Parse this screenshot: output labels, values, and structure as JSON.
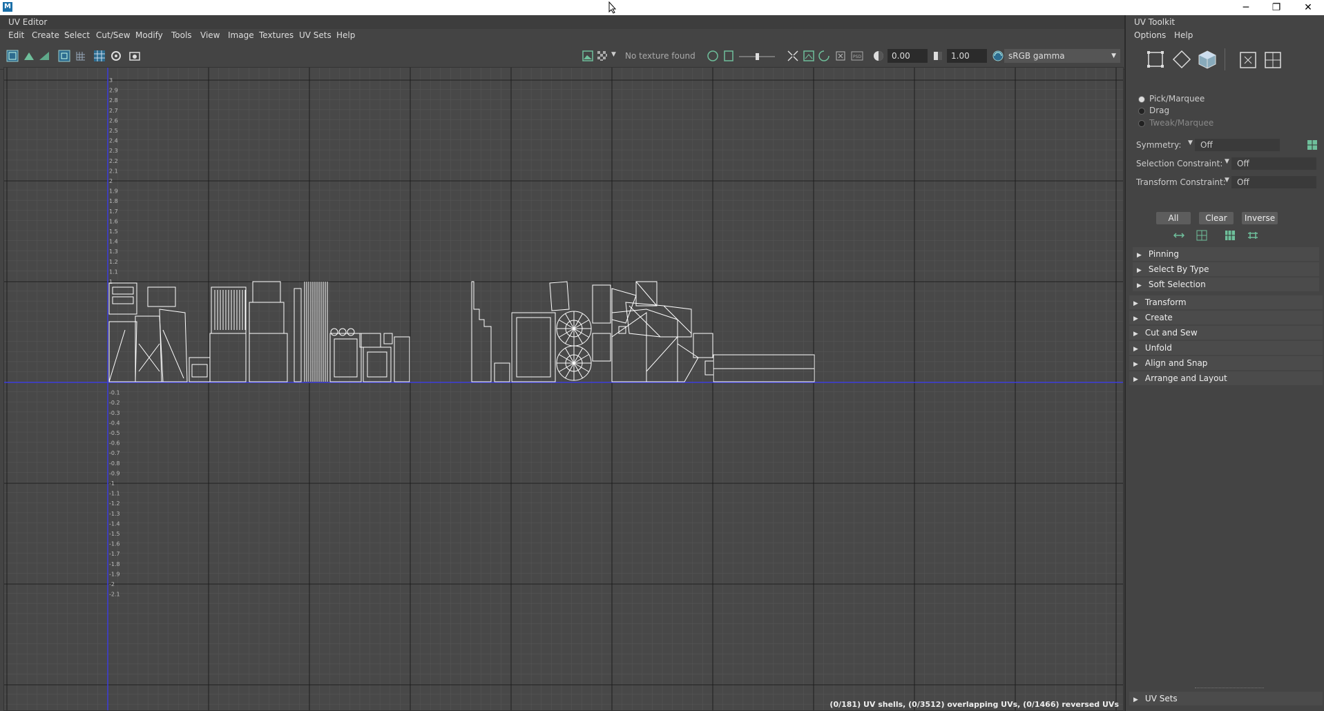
{
  "window": {
    "app_logo": "M",
    "minimize": "─",
    "restore": "❐",
    "close": "✕"
  },
  "uv_editor": {
    "title": "UV Editor",
    "menu": [
      "Edit",
      "Create",
      "Select",
      "Cut/Sew",
      "Modify",
      "Tools",
      "View",
      "Image",
      "Textures",
      "UV Sets",
      "Help"
    ],
    "texture_status": "No texture found",
    "exposure": "0.00",
    "gamma": "1.00",
    "color_space": "sRGB gamma",
    "status_bar": "(0/181) UV shells, (0/3512) overlapping UVs, (0/1466) reversed UVs",
    "axis_labels_v_pos": [
      "3",
      "2.9",
      "2.8",
      "2.7",
      "2.6",
      "2.5",
      "2.4",
      "2.3",
      "2.2",
      "2.1",
      "2",
      "1.9",
      "1.8",
      "1.7",
      "1.6",
      "1.5",
      "1.4",
      "1.3",
      "1.2",
      "1.1",
      "1"
    ],
    "axis_labels_v_neg": [
      "-0.1",
      "-0.2",
      "-0.3",
      "-0.4",
      "-0.5",
      "-0.6",
      "-0.7",
      "-0.8",
      "-0.9",
      "-1",
      "-1.1",
      "-1.2",
      "-1.3",
      "-1.4",
      "-1.5",
      "-1.6",
      "-1.7",
      "-1.8",
      "-1.9",
      "-2",
      "-2.1"
    ]
  },
  "uv_toolkit": {
    "title": "UV Toolkit",
    "menu": [
      "Options",
      "Help"
    ],
    "radio": [
      {
        "label": "Pick/Marquee",
        "selected": true
      },
      {
        "label": "Drag",
        "selected": false
      },
      {
        "label": "Tweak/Marquee",
        "selected": false
      }
    ],
    "symmetry_label": "Symmetry:",
    "symmetry_value": "Off",
    "selection_constraint_label": "Selection Constraint:",
    "selection_constraint_value": "Off",
    "transform_constraint_label": "Transform Constraint:",
    "transform_constraint_value": "Off",
    "buttons": {
      "all": "All",
      "clear": "Clear",
      "inverse": "Inverse"
    },
    "sections_a": [
      "Pinning",
      "Select By Type",
      "Soft Selection"
    ],
    "sections_b": [
      "Transform",
      "Create",
      "Cut and Sew",
      "Unfold",
      "Align and Snap",
      "Arrange and Layout"
    ],
    "uv_sets_section": "UV Sets"
  },
  "colors": {
    "viewport_bg": "#484848",
    "grid_major": "#1e1e1e",
    "grid_minor": "#555555",
    "axis_blue": "#3c3cdc",
    "uv_wire": "#ffffff",
    "accent_green": "#6fbf9b"
  }
}
